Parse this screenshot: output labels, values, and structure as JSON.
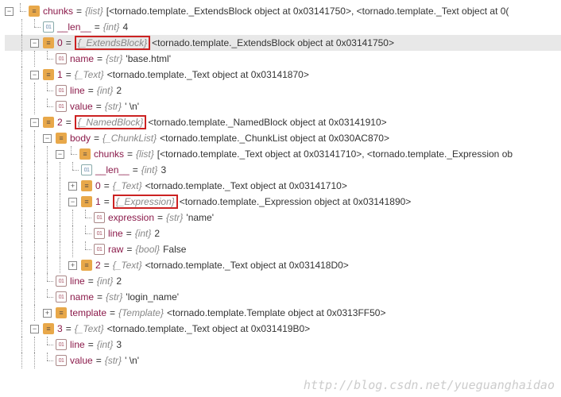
{
  "root": {
    "chunks_name": "chunks",
    "chunks_type": "{list}",
    "chunks_val": "[<tornado.template._ExtendsBlock object at 0x03141750>, <tornado.template._Text object at 0(",
    "len_name": "__len__",
    "len_type": "{int}",
    "len_val": "4",
    "i0": {
      "idx": "0",
      "box": "{_ExtendsBlock}",
      "val": "<tornado.template._ExtendsBlock object at 0x03141750>",
      "name_name": "name",
      "name_type": "{str}",
      "name_val": "'base.html'"
    },
    "i1": {
      "idx": "1",
      "type": "{_Text}",
      "val": "<tornado.template._Text object at 0x03141870>",
      "line_name": "line",
      "line_type": "{int}",
      "line_val": "2",
      "value_name": "value",
      "value_type": "{str}",
      "value_val": "' \\n'"
    },
    "i2": {
      "idx": "2",
      "box": "{_NamedBlock}",
      "val": "<tornado.template._NamedBlock object at 0x03141910>",
      "body_name": "body",
      "body_type": "{_ChunkList}",
      "body_val": "<tornado.template._ChunkList object at 0x030AC870>",
      "chunks_name": "chunks",
      "chunks_type": "{list}",
      "chunks_val": "[<tornado.template._Text object at 0x03141710>, <tornado.template._Expression ob",
      "len_name": "__len__",
      "len_type": "{int}",
      "len_val": "3",
      "c0": {
        "idx": "0",
        "type": "{_Text}",
        "val": "<tornado.template._Text object at 0x03141710>"
      },
      "c1": {
        "idx": "1",
        "box": "{_Expression}",
        "val": "<tornado.template._Expression object at 0x03141890>",
        "expr_name": "expression",
        "expr_type": "{str}",
        "expr_val": "'name'",
        "line_name": "line",
        "line_type": "{int}",
        "line_val": "2",
        "raw_name": "raw",
        "raw_type": "{bool}",
        "raw_val": "False"
      },
      "c2": {
        "idx": "2",
        "type": "{_Text}",
        "val": "<tornado.template._Text object at 0x031418D0>"
      },
      "line_name": "line",
      "line_type": "{int}",
      "line_val": "2",
      "name_name": "name",
      "name_type": "{str}",
      "name_val": "'login_name'",
      "tmpl_name": "template",
      "tmpl_type": "{Template}",
      "tmpl_val": "<tornado.template.Template object at 0x0313FF50>"
    },
    "i3": {
      "idx": "3",
      "type": "{_Text}",
      "val": "<tornado.template._Text object at 0x031419B0>",
      "line_name": "line",
      "line_type": "{int}",
      "line_val": "3",
      "value_name": "value",
      "value_type": "{str}",
      "value_val": "' \\n'"
    }
  },
  "watermark": "http://blog.csdn.net/yueguanghaidao"
}
